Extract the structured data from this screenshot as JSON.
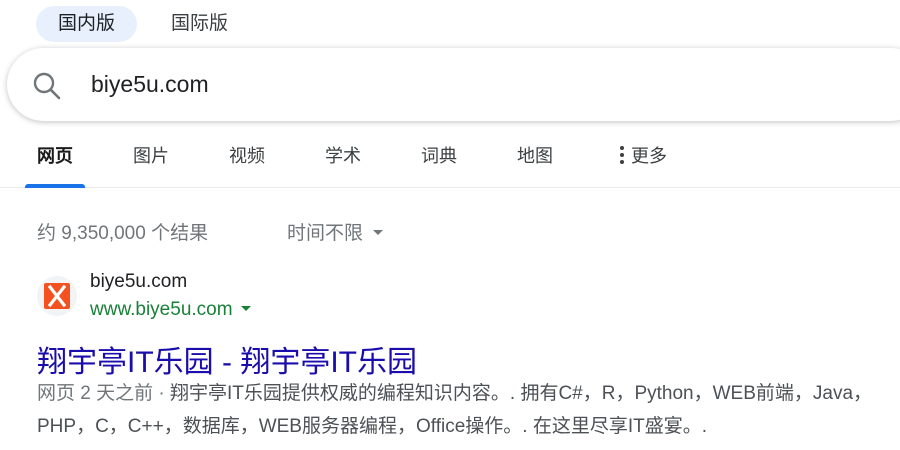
{
  "region": {
    "domestic": "国内版",
    "international": "国际版"
  },
  "search": {
    "query": "biye5u.com",
    "icon": "search-icon"
  },
  "tabs": [
    {
      "label": "网页",
      "active": true
    },
    {
      "label": "图片"
    },
    {
      "label": "视频"
    },
    {
      "label": "学术"
    },
    {
      "label": "词典"
    },
    {
      "label": "地图"
    },
    {
      "label": "更多",
      "icon": "more-vertical-icon"
    }
  ],
  "stats": {
    "count": "约 9,350,000 个结果",
    "time_filter": "时间不限"
  },
  "result": {
    "site_name": "biye5u.com",
    "url": "www.biye5u.com",
    "title": "翔宇亭IT乐园 - 翔宇亭IT乐园",
    "snippet_meta": "网页 2 天之前 · ",
    "snippet_text": "翔宇亭IT乐园提供权威的编程知识内容。. 拥有C#，R，Python，WEB前端，Java，PHP，C，C++，数据库，WEB服务器编程，Office操作。. 在这里尽享IT盛宴。.",
    "favicon_letter": "X",
    "favicon_color": "#f4511e"
  },
  "colors": {
    "accent": "#1a73e8",
    "link": "#1a0dab",
    "url": "#188038"
  }
}
